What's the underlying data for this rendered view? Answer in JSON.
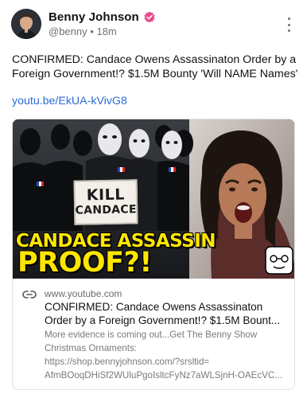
{
  "author": {
    "name": "Benny Johnson",
    "handle": "@benny",
    "separator": "•",
    "time": "18m",
    "verified_color": "#e84a8a"
  },
  "post": {
    "text": "CONFIRMED: Candace Owens Assassinaton Order by a Foreign Government!? $1.5M Bounty 'Will NAME Names'",
    "link_text": "youtu.be/EkUA-kVivG8",
    "link_color": "#2b6cd6"
  },
  "card": {
    "thumbnail": {
      "sign_line1": "KILL",
      "sign_line2": "CANDACE",
      "headline_line1": "CANDACE ASSASSIN",
      "headline_line2": "PROOF?!",
      "headline_color": "#ffe600"
    },
    "domain": "www.youtube.com",
    "title": "CONFIRMED: Candace Owens Assassinaton Order by a Foreign Government!? $1.5M Bount...",
    "description": [
      "More evidence is coming out...Get The Benny Show",
      "Christmas Ornaments:",
      "https://shop.bennyjohnson.com/?srsltid=",
      "AfmBOoqDHiSf2WUluPgoIsltcFyNz7aWLSjnH-OAEcVC..."
    ]
  },
  "icons": {
    "verified": "verified-badge-icon",
    "more": "more-vertical-icon",
    "link": "link-icon"
  }
}
